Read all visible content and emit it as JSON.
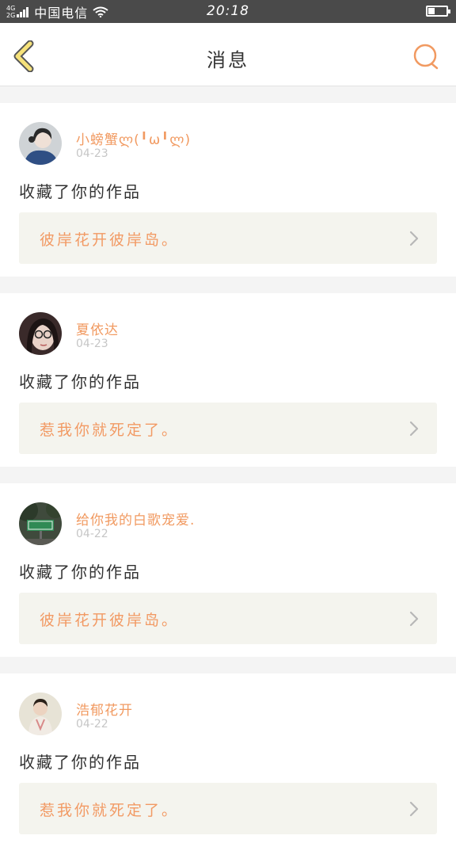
{
  "status_bar": {
    "network_top": "4G",
    "network_bottom": "2G",
    "carrier": "中国电信",
    "time": "20:18",
    "battery_level": 0.35
  },
  "nav": {
    "title": "消息"
  },
  "messages": [
    {
      "user": "小螃蟹ლ(╹ω╹ლ)",
      "time": "04-23",
      "action": "收藏了你的作品",
      "work_title": "彼岸花开彼岸岛。"
    },
    {
      "user": "夏依达",
      "time": "04-23",
      "action": "收藏了你的作品",
      "work_title": "惹我你就死定了。"
    },
    {
      "user": "给你我的白歌宠爱.",
      "time": "04-22",
      "action": "收藏了你的作品",
      "work_title": "彼岸花开彼岸岛。"
    },
    {
      "user": "浩郁花开",
      "time": "04-22",
      "action": "收藏了你的作品",
      "work_title": "惹我你就死定了。"
    }
  ],
  "colors": {
    "accent": "#f19a61",
    "back_icon_fill": "#f6e27a",
    "status_bar": "#4a4a4a"
  }
}
